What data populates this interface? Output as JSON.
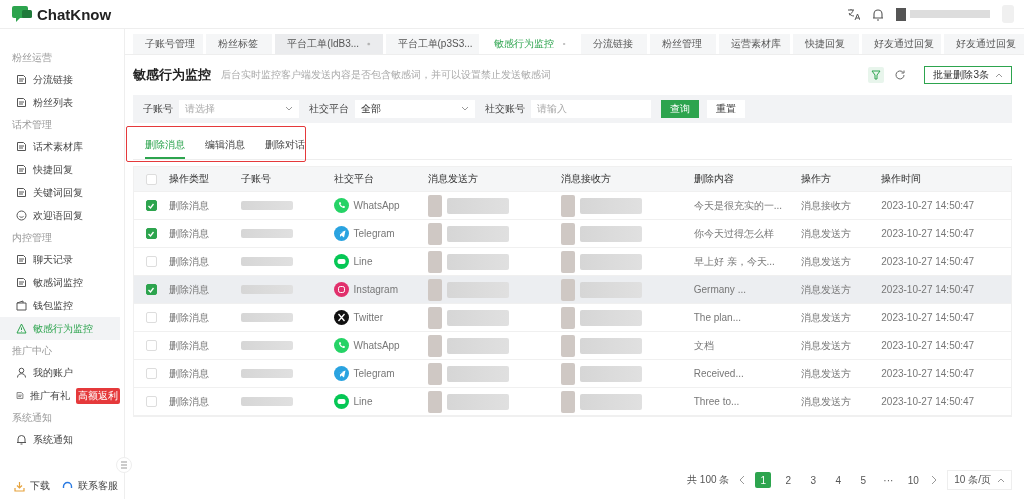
{
  "brand": {
    "name": "ChatKnow"
  },
  "sidebar": {
    "groups": [
      {
        "label": "粉丝运营",
        "items": [
          {
            "label": "分流链接",
            "selected": false
          },
          {
            "label": "粉丝列表",
            "selected": false
          }
        ]
      },
      {
        "label": "话术管理",
        "items": [
          {
            "label": "话术素材库",
            "selected": false
          },
          {
            "label": "快捷回复",
            "selected": false
          },
          {
            "label": "关键词回复",
            "selected": false
          },
          {
            "label": "欢迎语回复",
            "selected": false
          }
        ]
      },
      {
        "label": "内控管理",
        "items": [
          {
            "label": "聊天记录",
            "selected": false
          },
          {
            "label": "敏感词监控",
            "selected": false
          },
          {
            "label": "钱包监控",
            "selected": false
          },
          {
            "label": "敏感行为监控",
            "selected": true
          }
        ]
      },
      {
        "label": "推广中心",
        "items": [
          {
            "label": "我的账户",
            "selected": false
          },
          {
            "label": "推广有礼",
            "selected": false,
            "badge": "高额返利"
          }
        ]
      },
      {
        "label": "系统通知",
        "items": [
          {
            "label": "系统通知",
            "selected": false
          }
        ]
      }
    ],
    "footer": [
      {
        "label": "下载"
      },
      {
        "label": "联系客服"
      }
    ]
  },
  "page_tabs": [
    {
      "label": "子账号管理",
      "selected": false,
      "closable": false
    },
    {
      "label": "粉丝标签",
      "selected": false,
      "closable": false
    },
    {
      "label": "平台工单(ldB3...",
      "selected": false,
      "closable": true
    },
    {
      "label": "平台工单(p3S3...",
      "selected": false,
      "closable": false
    },
    {
      "label": "敏感行为监控",
      "selected": true,
      "closable": true
    },
    {
      "label": "分流链接",
      "selected": false,
      "closable": false
    },
    {
      "label": "粉丝管理",
      "selected": false,
      "closable": false
    },
    {
      "label": "运营素材库",
      "selected": false,
      "closable": false
    },
    {
      "label": "快捷回复",
      "selected": false,
      "closable": false
    },
    {
      "label": "好友通过回复",
      "selected": false,
      "closable": false
    },
    {
      "label": "好友通过回复",
      "selected": false,
      "closable": false
    }
  ],
  "page": {
    "title": "敏感行为监控",
    "subtitle": "后台实时监控客户端发送内容是否包含敏感词，并可以设置禁止发送敏感词",
    "bulk_button": "批量删除3条"
  },
  "filters": {
    "fields": [
      {
        "label": "子账号",
        "placeholder": "请选择",
        "kind": "select"
      },
      {
        "label": "社交平台",
        "value": "全部",
        "kind": "select"
      },
      {
        "label": "社交账号",
        "placeholder": "请输入",
        "kind": "input"
      }
    ],
    "search_button": "查询",
    "reset_button": "重置"
  },
  "sub_tabs": [
    {
      "label": "删除消息",
      "selected": true
    },
    {
      "label": "编辑消息",
      "selected": false
    },
    {
      "label": "删除对话",
      "selected": false
    }
  ],
  "table": {
    "columns": [
      "操作类型",
      "子账号",
      "社交平台",
      "消息发送方",
      "消息接收方",
      "删除内容",
      "操作方",
      "操作时间"
    ],
    "header_checked": false,
    "rows": [
      {
        "checked": true,
        "hovered": false,
        "type": "删除消息",
        "platform": {
          "name": "WhatsApp",
          "kind": "whatsapp"
        },
        "content": "今天是很充实的一...",
        "operator": "消息接收方",
        "time": "2023-10-27 14:50:47"
      },
      {
        "checked": true,
        "hovered": false,
        "type": "删除消息",
        "platform": {
          "name": "Telegram",
          "kind": "telegram"
        },
        "content": "你今天过得怎么样",
        "operator": "消息发送方",
        "time": "2023-10-27 14:50:47"
      },
      {
        "checked": false,
        "hovered": false,
        "type": "删除消息",
        "platform": {
          "name": "Line",
          "kind": "line"
        },
        "content": "早上好 亲，今天...",
        "operator": "消息发送方",
        "time": "2023-10-27 14:50:47"
      },
      {
        "checked": true,
        "hovered": true,
        "type": "删除消息",
        "platform": {
          "name": "Instagram",
          "kind": "instagram"
        },
        "content": "Germany ...",
        "operator": "消息发送方",
        "time": "2023-10-27 14:50:47"
      },
      {
        "checked": false,
        "hovered": false,
        "type": "删除消息",
        "platform": {
          "name": "Twitter",
          "kind": "twitter"
        },
        "content": "The plan...",
        "operator": "消息发送方",
        "time": "2023-10-27 14:50:47"
      },
      {
        "checked": false,
        "hovered": false,
        "type": "删除消息",
        "platform": {
          "name": "WhatsApp",
          "kind": "whatsapp"
        },
        "content": "文档",
        "operator": "消息发送方",
        "time": "2023-10-27 14:50:47"
      },
      {
        "checked": false,
        "hovered": false,
        "type": "删除消息",
        "platform": {
          "name": "Telegram",
          "kind": "telegram"
        },
        "content": "Received...",
        "operator": "消息发送方",
        "time": "2023-10-27 14:50:47"
      },
      {
        "checked": false,
        "hovered": false,
        "type": "删除消息",
        "platform": {
          "name": "Line",
          "kind": "line"
        },
        "content": "Three to...",
        "operator": "消息发送方",
        "time": "2023-10-27 14:50:47"
      }
    ]
  },
  "pagination": {
    "total": "共 100 条",
    "pages": [
      {
        "label": "1",
        "selected": true
      },
      {
        "label": "2",
        "selected": false
      },
      {
        "label": "3",
        "selected": false
      },
      {
        "label": "4",
        "selected": false
      },
      {
        "label": "5",
        "selected": false
      },
      {
        "label": "···",
        "selected": false
      },
      {
        "label": "10",
        "selected": false
      }
    ],
    "page_size": "10 条/页"
  }
}
